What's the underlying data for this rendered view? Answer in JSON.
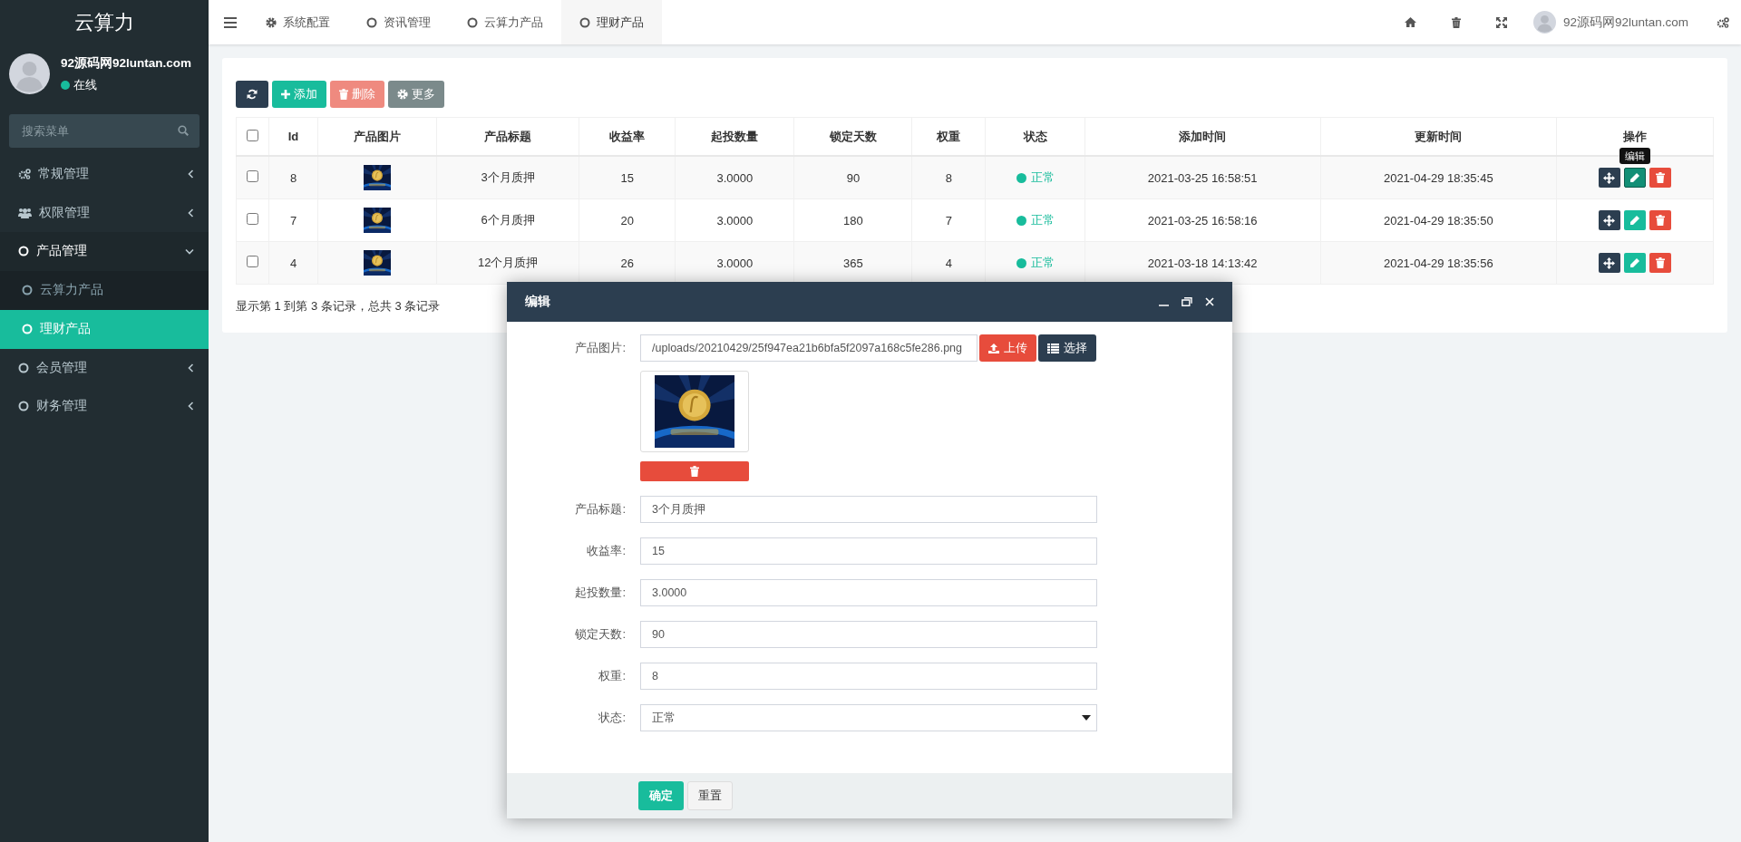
{
  "sidebar": {
    "logo": "云算力",
    "user": {
      "name": "92源码网92luntan.com",
      "status": "在线"
    },
    "search": {
      "placeholder": "搜索菜单"
    },
    "items": [
      {
        "label": "常规管理",
        "expanded": false,
        "selected": false
      },
      {
        "label": "权限管理",
        "expanded": false,
        "selected": false
      },
      {
        "label": "产品管理",
        "expanded": true,
        "selected": false,
        "children": [
          {
            "label": "云算力产品",
            "selected": false
          },
          {
            "label": "理财产品",
            "selected": true
          }
        ]
      },
      {
        "label": "会员管理",
        "expanded": false,
        "selected": false
      },
      {
        "label": "财务管理",
        "expanded": false,
        "selected": false
      }
    ]
  },
  "topbar": {
    "tabs": [
      {
        "label": "系统配置",
        "selected": false
      },
      {
        "label": "资讯管理",
        "selected": false
      },
      {
        "label": "云算力产品",
        "selected": false
      },
      {
        "label": "理财产品",
        "selected": true
      }
    ],
    "tools": [
      {
        "kind": "home"
      },
      {
        "kind": "trash"
      },
      {
        "kind": "expand"
      }
    ],
    "user": "92源码网92luntan.com"
  },
  "toolbar": {
    "buttons": [
      {
        "kind": "refresh",
        "disabled": false
      },
      {
        "kind": "add",
        "label": "添加",
        "disabled": false
      },
      {
        "kind": "delete",
        "label": "删除",
        "disabled": true
      },
      {
        "kind": "more",
        "label": "更多",
        "disabled": false
      }
    ]
  },
  "table": {
    "select_all_checked": false,
    "columns": [
      "Id",
      "产品图片",
      "产品标题",
      "收益率",
      "起投数量",
      "锁定天数",
      "权重",
      "状态",
      "添加时间",
      "更新时间",
      "操作"
    ],
    "tooltip": "编辑",
    "rows": [
      {
        "checked": false,
        "id": "8",
        "title": "3个月质押",
        "rate": "15",
        "min_amount": "3.0000",
        "lock_days": "90",
        "weight": "8",
        "status": "正常",
        "created": "2021-03-25 16:58:51",
        "updated": "2021-04-29 18:35:45",
        "edit_hovered": true
      },
      {
        "checked": false,
        "id": "7",
        "title": "6个月质押",
        "rate": "20",
        "min_amount": "3.0000",
        "lock_days": "180",
        "weight": "7",
        "status": "正常",
        "created": "2021-03-25 16:58:16",
        "updated": "2021-04-29 18:35:50",
        "edit_hovered": false
      },
      {
        "checked": false,
        "id": "4",
        "title": "12个月质押",
        "rate": "26",
        "min_amount": "3.0000",
        "lock_days": "365",
        "weight": "4",
        "status": "正常",
        "created": "2021-03-18 14:13:42",
        "updated": "2021-04-29 18:35:56",
        "edit_hovered": false
      }
    ]
  },
  "pagination": "显示第 1 到第 3 条记录，总共 3 条记录",
  "dialog": {
    "title": "编辑",
    "image_field": {
      "label": "产品图片:",
      "value": "/uploads/20210429/25f947ea21b6bfa5f2097a168c5fe286.png",
      "upload": "上传",
      "choose": "选择"
    },
    "fields": [
      {
        "kind": "text",
        "label": "产品标题:",
        "value": "3个月质押"
      },
      {
        "kind": "text",
        "label": "收益率:",
        "value": "15"
      },
      {
        "kind": "text",
        "label": "起投数量:",
        "value": "3.0000"
      },
      {
        "kind": "text",
        "label": "锁定天数:",
        "value": "90"
      },
      {
        "kind": "text",
        "label": "权重:",
        "value": "8"
      },
      {
        "kind": "select",
        "label": "状态:",
        "value": "正常"
      }
    ],
    "buttons": [
      {
        "kind": "primary",
        "label": "确定"
      },
      {
        "kind": "default",
        "label": "重置"
      }
    ]
  }
}
